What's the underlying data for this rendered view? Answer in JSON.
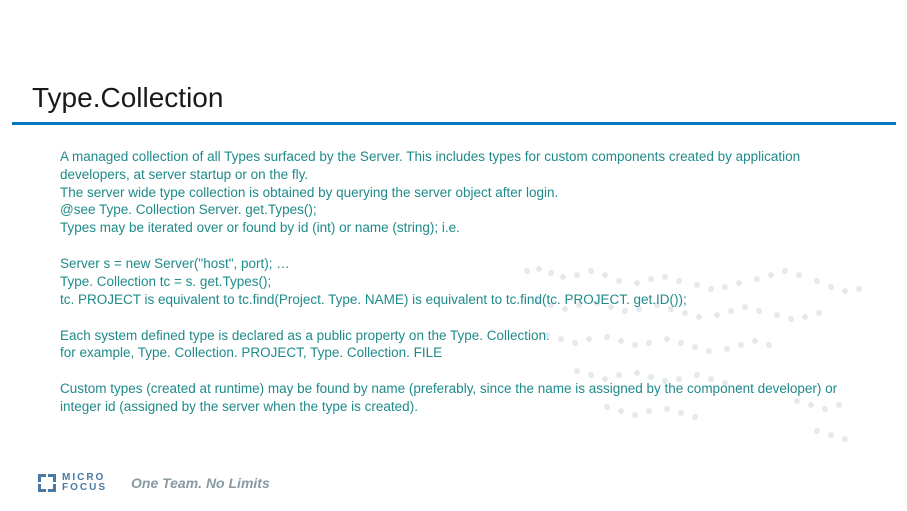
{
  "title": "Type.Collection",
  "paragraphs": {
    "p1": "A managed collection of all Types surfaced by the Server. This includes types for custom components created by application developers, at server startup or on the fly.\nThe server wide type collection is obtained by querying the server object after login.\n@see Type. Collection Server. get.Types();\nTypes may be iterated over or found by id (int) or name (string); i.e.",
    "p2": "Server s = new Server(\"host\", port); …\nType. Collection tc = s. get.Types();\ntc. PROJECT is equivalent to tc.find(Project. Type. NAME) is equivalent to tc.find(tc. PROJECT. get.ID());",
    "p3": "Each system defined type is declared as a public property on the Type. Collection.\nfor example, Type. Collection. PROJECT, Type. Collection. FILE",
    "p4": "Custom types (created at runtime) may be found by name (preferably, since the name is assigned by the component developer) or integer id (assigned by the server when the type is created)."
  },
  "footer": {
    "logo_line1": "MICRO",
    "logo_line2": "FOCUS",
    "tagline": "One Team. No Limits"
  }
}
